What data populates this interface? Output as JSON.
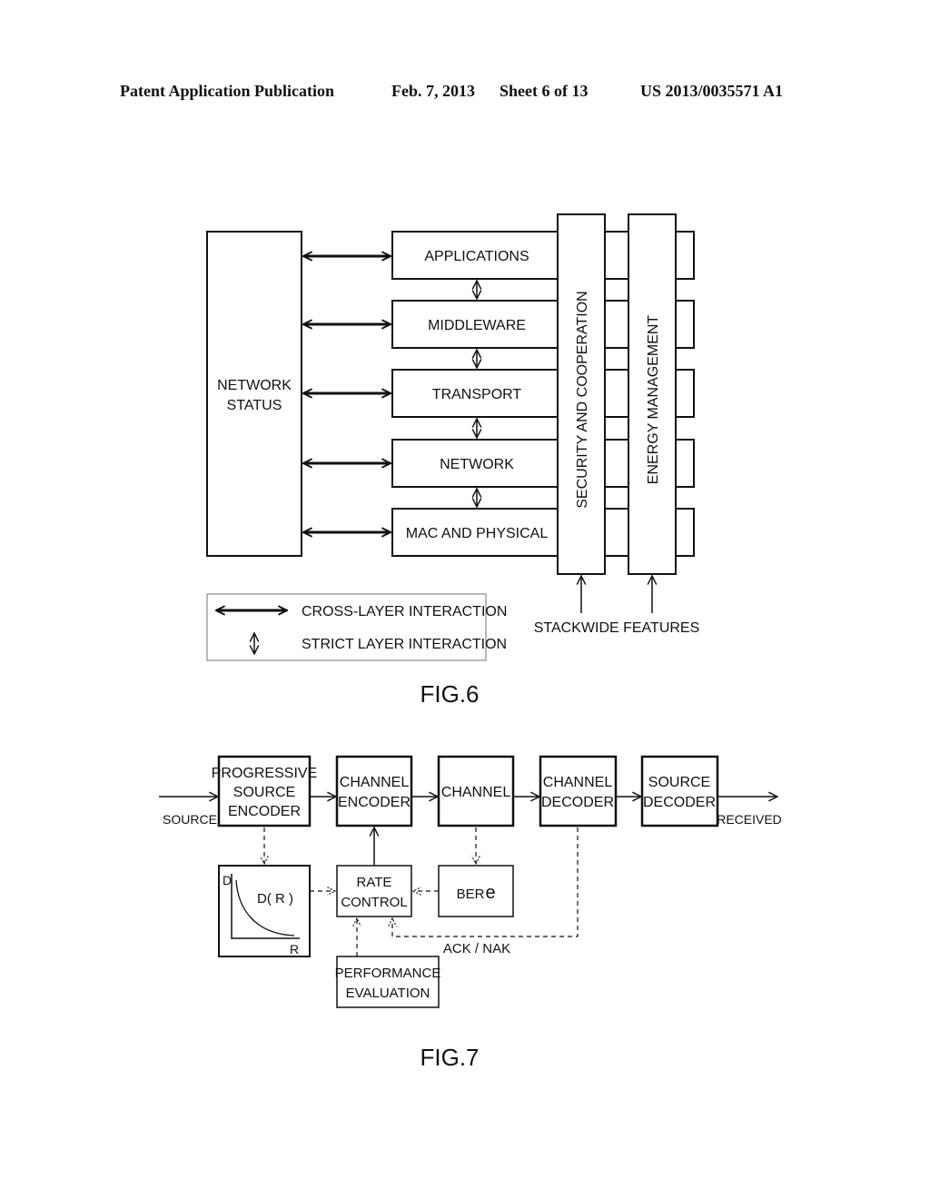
{
  "header": {
    "publication": "Patent Application Publication",
    "date": "Feb. 7, 2013",
    "sheet": "Sheet 6 of 13",
    "number": "US 2013/0035571 A1"
  },
  "fig6": {
    "caption": "FIG.6",
    "network_status": [
      "NETWORK",
      "STATUS"
    ],
    "layers": [
      "APPLICATIONS",
      "MIDDLEWARE",
      "TRANSPORT",
      "NETWORK",
      "MAC AND PHYSICAL"
    ],
    "stackwide": [
      "SECURITY AND COOPERATION",
      "ENERGY MANAGEMENT"
    ],
    "stackwide_label": "STACKWIDE FEATURES",
    "legend": {
      "cross_layer": "CROSS-LAYER INTERACTION",
      "strict_layer": "STRICT LAYER INTERACTION"
    }
  },
  "fig7": {
    "caption": "FIG.7",
    "source_label": "SOURCE",
    "received_label": "RECEIVED",
    "blocks": {
      "progressive_source_encoder": [
        "PROGRESSIVE",
        "SOURCE",
        "ENCODER"
      ],
      "channel_encoder": [
        "CHANNEL",
        "ENCODER"
      ],
      "channel": [
        "CHANNEL"
      ],
      "channel_decoder": [
        "CHANNEL",
        "DECODER"
      ],
      "source_decoder": [
        "SOURCE",
        "DECODER"
      ],
      "rate_control": [
        "RATE",
        "CONTROL"
      ],
      "ber": "BER",
      "ber_symbol": "e",
      "performance_evaluation": [
        "PERFORMANCE",
        "EVALUATION"
      ]
    },
    "dr_plot": {
      "y_axis": "D",
      "x_axis": "R",
      "curve_label": "D( R )"
    },
    "ack_nak": "ACK / NAK"
  }
}
